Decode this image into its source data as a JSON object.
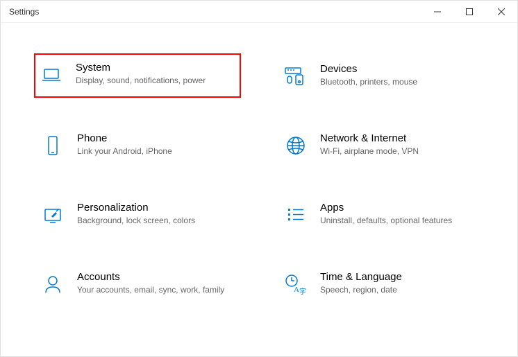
{
  "window": {
    "title": "Settings"
  },
  "tiles": [
    {
      "icon": "laptop-icon",
      "title": "System",
      "desc": "Display, sound, notifications, power",
      "highlighted": true
    },
    {
      "icon": "devices-icon",
      "title": "Devices",
      "desc": "Bluetooth, printers, mouse",
      "highlighted": false
    },
    {
      "icon": "phone-icon",
      "title": "Phone",
      "desc": "Link your Android, iPhone",
      "highlighted": false
    },
    {
      "icon": "globe-icon",
      "title": "Network & Internet",
      "desc": "Wi-Fi, airplane mode, VPN",
      "highlighted": false
    },
    {
      "icon": "personalization-icon",
      "title": "Personalization",
      "desc": "Background, lock screen, colors",
      "highlighted": false
    },
    {
      "icon": "apps-icon",
      "title": "Apps",
      "desc": "Uninstall, defaults, optional features",
      "highlighted": false
    },
    {
      "icon": "accounts-icon",
      "title": "Accounts",
      "desc": "Your accounts, email, sync, work, family",
      "highlighted": false
    },
    {
      "icon": "time-language-icon",
      "title": "Time & Language",
      "desc": "Speech, region, date",
      "highlighted": false
    }
  ],
  "colors": {
    "accent": "#0078d4",
    "highlight": "#ff0000"
  }
}
